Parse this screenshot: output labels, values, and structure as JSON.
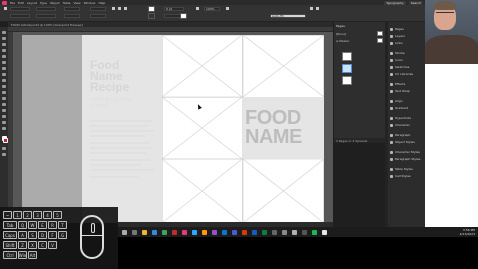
{
  "app": {
    "menu": [
      "File",
      "Edit",
      "Layout",
      "Type",
      "Object",
      "Table",
      "View",
      "Window",
      "Help"
    ],
    "workspace": "Typography",
    "search_placeholder": "Search"
  },
  "control_bar": {
    "stroke_weight": "0 pt",
    "zoom": "100%",
    "auto_fit": "Auto-Fit",
    "fill_color": "#ffffff"
  },
  "document": {
    "tab_title": "FOOD Activity.indd @ 100% [Overprint Preview]"
  },
  "layout": {
    "recipe_title_lines": [
      "Food",
      "Name",
      "Recipe"
    ],
    "recipe_subtitle": [
      "Lorem ipsum dolor",
      "sit amet"
    ],
    "food_name_lines": [
      "FOOD",
      "NAME"
    ]
  },
  "pages_panel": {
    "tab": "Pages",
    "labels": [
      "[None]",
      "A-Master"
    ],
    "footer": "3 Pages in 3 Spreads"
  },
  "right_panels": {
    "items": [
      "Pages",
      "Layers",
      "Links",
      "Stroke",
      "Color",
      "Swatches",
      "CC Libraries",
      "Effects",
      "Text Wrap",
      "Align",
      "Gradient",
      "Hyperlinks",
      "Character",
      "Paragraph",
      "Object Styles",
      "Character Styles",
      "Paragraph Styles",
      "Table Styles",
      "Cell Styles"
    ]
  },
  "keyboard_overlay": {
    "row1": [
      "~",
      "1",
      "2",
      "3",
      "4",
      "5"
    ],
    "row2": [
      "Tab",
      "Q",
      "W",
      "E",
      "R",
      "T"
    ],
    "row3": [
      "Caps",
      "A",
      "S",
      "D",
      "F",
      "G"
    ],
    "row4": [
      "Shift",
      "Z",
      "X",
      "C",
      "V"
    ],
    "row5": [
      "Ctrl",
      "Win",
      "Alt"
    ]
  },
  "taskbar": {
    "time": "3:56 PM",
    "date": "4/13/2023"
  },
  "colors": {
    "app_bg": "#1f1f1f",
    "panel_bg": "#2e2e2e",
    "pasteboard": "#ababab",
    "accent": "#e43a7a",
    "selection": "#4a90e2"
  }
}
